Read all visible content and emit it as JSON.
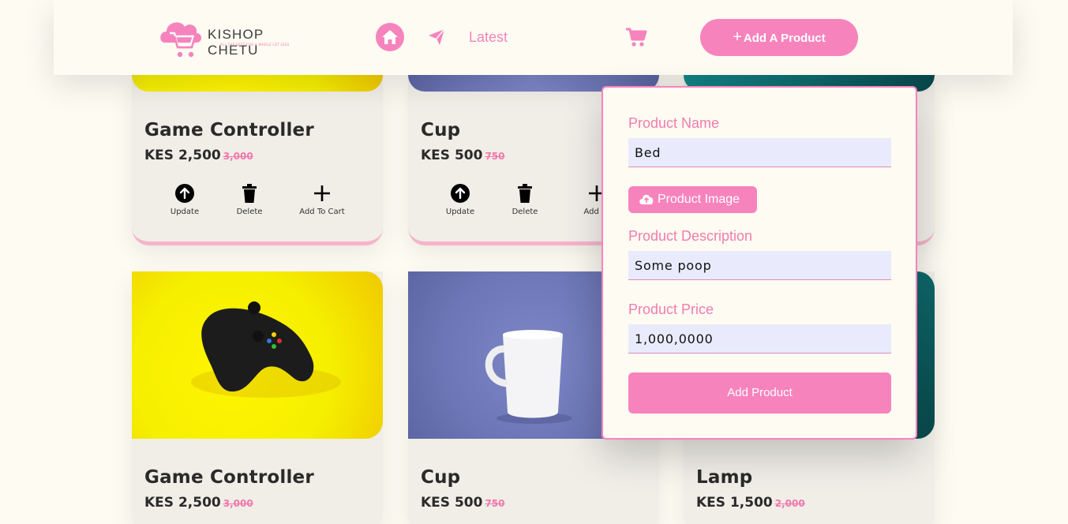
{
  "header": {
    "brand": "KISHOP CHETU",
    "tagline": "ALL THE BEST FOR A WHOLE LOT LESS",
    "nav_latest": "Latest",
    "add_product_label": "Add A Product",
    "icons": [
      "home-icon",
      "send-icon",
      "cart-icon",
      "plus-icon"
    ]
  },
  "cards_top": [
    {
      "name": "Game Controller",
      "price": "KES 2,500",
      "old_price": "3,000",
      "actions": [
        {
          "label": "Update"
        },
        {
          "label": "Delete"
        },
        {
          "label": "Add To Cart"
        }
      ]
    },
    {
      "name": "Cup",
      "price": "KES 500",
      "old_price": "750",
      "actions": [
        {
          "label": "Update"
        },
        {
          "label": "Delete"
        },
        {
          "label": "Add To"
        }
      ]
    }
  ],
  "cards_bottom": [
    {
      "name": "Game Controller",
      "price": "KES 2,500",
      "old_price": "3,000"
    },
    {
      "name": "Cup",
      "price": "KES 500",
      "old_price": "750"
    },
    {
      "name": "Lamp",
      "price": "KES 1,500",
      "old_price": "2,000"
    }
  ],
  "form": {
    "name_label": "Product Name",
    "name_value": "Bed",
    "image_button": "Product Image",
    "description_label": "Product Description",
    "description_value": "Some poop",
    "price_label": "Product Price",
    "price_value": "1,000,0000",
    "submit_label": "Add Product"
  },
  "colors": {
    "accent": "#f783bd",
    "background": "#fdfbf2",
    "card": "#f0eee7",
    "input": "#e9ebfc"
  }
}
